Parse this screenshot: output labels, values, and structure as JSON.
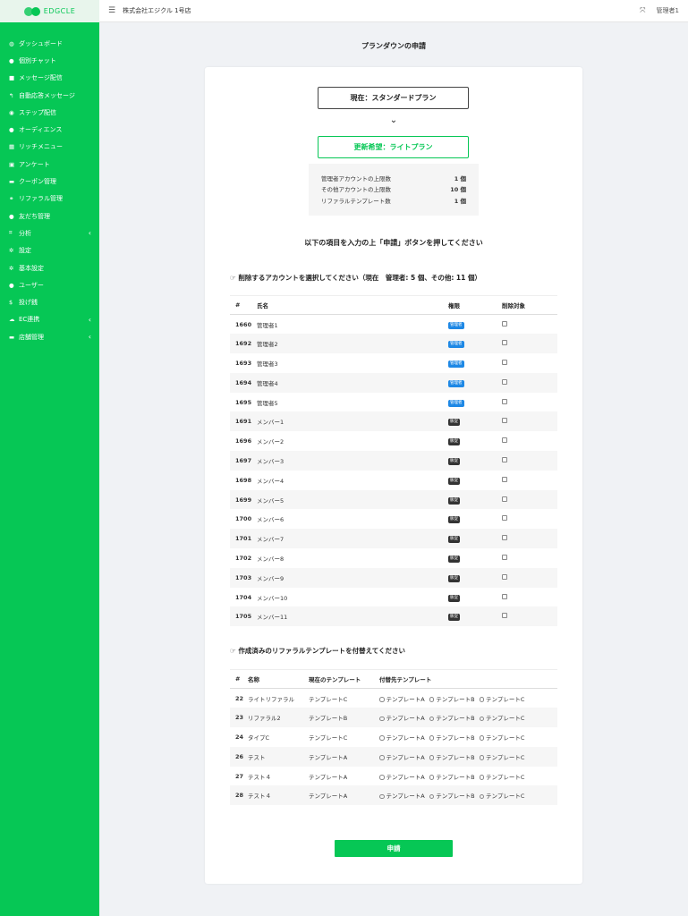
{
  "brand": {
    "logo_text": "EDGCLE"
  },
  "header": {
    "store_name": "株式会社エジクル 1号店",
    "user": "管理者1"
  },
  "sidebar": {
    "items": [
      {
        "icon": "dashboard-icon",
        "glyph": "◍",
        "label": "ダッシュボード",
        "chevron": ""
      },
      {
        "icon": "chat-icon",
        "glyph": "●",
        "label": "個別チャット",
        "chevron": ""
      },
      {
        "icon": "message-icon",
        "glyph": "■",
        "label": "メッセージ配信",
        "chevron": ""
      },
      {
        "icon": "reply-icon",
        "glyph": "↰",
        "label": "自動応答メッセージ",
        "chevron": ""
      },
      {
        "icon": "step-icon",
        "glyph": "◉",
        "label": "ステップ配信",
        "chevron": ""
      },
      {
        "icon": "audience-icon",
        "glyph": "●",
        "label": "オーディエンス",
        "chevron": ""
      },
      {
        "icon": "rich-menu-icon",
        "glyph": "▦",
        "label": "リッチメニュー",
        "chevron": ""
      },
      {
        "icon": "survey-icon",
        "glyph": "▣",
        "label": "アンケート",
        "chevron": ""
      },
      {
        "icon": "coupon-icon",
        "glyph": "▬",
        "label": "クーポン管理",
        "chevron": ""
      },
      {
        "icon": "referral-icon",
        "glyph": "⚭",
        "label": "リファラル管理",
        "chevron": ""
      },
      {
        "icon": "friends-icon",
        "glyph": "●",
        "label": "友だち管理",
        "chevron": ""
      },
      {
        "icon": "chart-icon",
        "glyph": "⌗",
        "label": "分析",
        "chevron": "‹"
      },
      {
        "icon": "gear-icon",
        "glyph": "✲",
        "label": "設定",
        "chevron": ""
      },
      {
        "icon": "gear-icon",
        "glyph": "✲",
        "label": "基本設定",
        "chevron": ""
      },
      {
        "icon": "user-icon",
        "glyph": "●",
        "label": "ユーザー",
        "chevron": ""
      },
      {
        "icon": "dollar-icon",
        "glyph": "$",
        "label": "投げ銭",
        "chevron": ""
      },
      {
        "icon": "cloud-icon",
        "glyph": "☁",
        "label": "EC連携",
        "chevron": "‹"
      },
      {
        "icon": "store-icon",
        "glyph": "▬",
        "label": "店舗管理",
        "chevron": "‹"
      }
    ]
  },
  "page": {
    "title": "プランダウンの申請",
    "current_plan": "現在：スタンダードプラン",
    "new_plan": "更新希望：ライトプラン",
    "limits": [
      {
        "label": "管理者アカウントの上限数",
        "value": "1 個"
      },
      {
        "label": "その他アカウントの上限数",
        "value": "10 個"
      },
      {
        "label": "リファラルテンプレート数",
        "value": "1 個"
      }
    ],
    "instruction": "以下の項目を入力の上「申請」ボタンを押してください",
    "accounts_section": {
      "title": "☞ 削除するアカウントを選択してください（現在　管理者: 5 個、その他: 11 個）",
      "headers": [
        "#",
        "氏名",
        "権限",
        "削除対象"
      ],
      "rows": [
        {
          "id": "1660",
          "name": "管理者1",
          "role": "管理者",
          "role_type": "admin"
        },
        {
          "id": "1692",
          "name": "管理者2",
          "role": "管理者",
          "role_type": "admin"
        },
        {
          "id": "1693",
          "name": "管理者3",
          "role": "管理者",
          "role_type": "admin"
        },
        {
          "id": "1694",
          "name": "管理者4",
          "role": "管理者",
          "role_type": "admin"
        },
        {
          "id": "1695",
          "name": "管理者5",
          "role": "管理者",
          "role_type": "admin"
        },
        {
          "id": "1691",
          "name": "メンバー1",
          "role": "販促",
          "role_type": "member"
        },
        {
          "id": "1696",
          "name": "メンバー2",
          "role": "販促",
          "role_type": "member"
        },
        {
          "id": "1697",
          "name": "メンバー3",
          "role": "販促",
          "role_type": "member"
        },
        {
          "id": "1698",
          "name": "メンバー4",
          "role": "販促",
          "role_type": "member"
        },
        {
          "id": "1699",
          "name": "メンバー5",
          "role": "販促",
          "role_type": "member"
        },
        {
          "id": "1700",
          "name": "メンバー6",
          "role": "販促",
          "role_type": "member"
        },
        {
          "id": "1701",
          "name": "メンバー7",
          "role": "販促",
          "role_type": "member"
        },
        {
          "id": "1702",
          "name": "メンバー8",
          "role": "販促",
          "role_type": "member"
        },
        {
          "id": "1703",
          "name": "メンバー9",
          "role": "販促",
          "role_type": "member"
        },
        {
          "id": "1704",
          "name": "メンバー10",
          "role": "販促",
          "role_type": "member"
        },
        {
          "id": "1705",
          "name": "メンバー11",
          "role": "販促",
          "role_type": "member"
        }
      ]
    },
    "templates_section": {
      "title": "☞ 作成済みのリファラルテンプレートを付替えてください",
      "headers": [
        "#",
        "名称",
        "現在のテンプレート",
        "付替先テンプレート"
      ],
      "options": [
        "テンプレートA",
        "テンプレートB",
        "テンプレートC"
      ],
      "rows": [
        {
          "id": "22",
          "name": "ライトリファラル",
          "current": "テンプレートC"
        },
        {
          "id": "23",
          "name": "リファラル2",
          "current": "テンプレートB"
        },
        {
          "id": "24",
          "name": "タイプC",
          "current": "テンプレートC"
        },
        {
          "id": "26",
          "name": "テスト",
          "current": "テンプレートA"
        },
        {
          "id": "27",
          "name": "テスト４",
          "current": "テンプレートA"
        },
        {
          "id": "28",
          "name": "テスト４",
          "current": "テンプレートA"
        }
      ]
    },
    "submit_label": "申請"
  },
  "colors": {
    "brand": "#06c755",
    "admin_badge": "#1e88e5",
    "member_badge": "#333333"
  }
}
